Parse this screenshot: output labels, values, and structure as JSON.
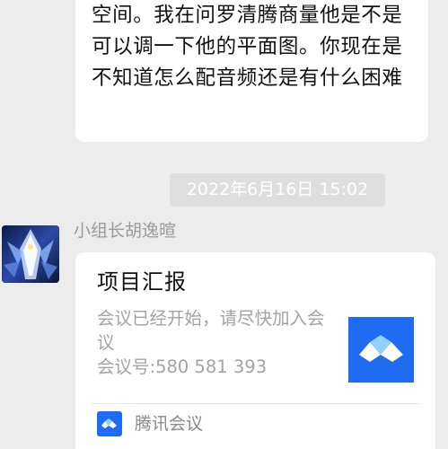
{
  "top_message": {
    "text": "空间。我在问罗清腾商量他是不是可以调一下他的平面图。你现在是不知道怎么配音频还是有什么困难"
  },
  "timestamp": "2022年6月16日 15:02",
  "sender": {
    "name": "小组长胡逸暄",
    "avatar_icon": "avatar-image"
  },
  "meeting_card": {
    "title": "项目汇报",
    "description_line1": "会议已经开始，请尽快加入会议",
    "meeting_id": "会议号:580 581 393",
    "thumbnail_icon": "tencent-meeting-logo-icon",
    "footer_app": "腾讯会议",
    "brand_color": "#1f6bf2"
  }
}
